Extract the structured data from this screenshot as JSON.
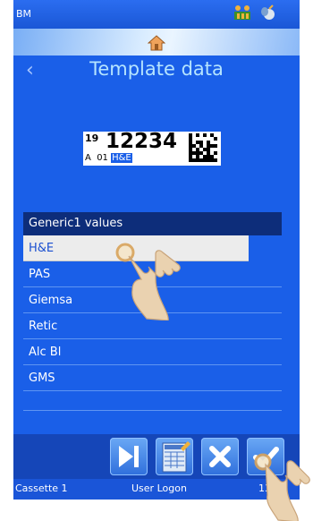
{
  "statusbar": {
    "title": "BM"
  },
  "header": {
    "title": "Template data"
  },
  "label_preview": {
    "sup": "19",
    "number": "12234",
    "prefix": "A  01 ",
    "selected": "H&E"
  },
  "list": {
    "header": "Generic1 values",
    "items": [
      "H&E",
      "PAS",
      "Giemsa",
      "Retic",
      "Alc Bl",
      "GMS"
    ],
    "selected_index": 0
  },
  "footer": {
    "left": "Cassette 1",
    "center": "User Logon",
    "right": "13 4"
  },
  "icons": {
    "status_left": "printer-ink-icon",
    "status_right": "mouse-icon",
    "home": "home-icon",
    "back": "back-chevron-icon",
    "skip": "skip-forward-icon",
    "edit": "edit-template-icon",
    "cancel": "close-icon",
    "confirm": "checkmark-icon"
  },
  "colors": {
    "background": "#1a5fe8",
    "list_header": "#0d2d7a",
    "title": "#b5e4ff",
    "accent": "#f2b23a"
  }
}
